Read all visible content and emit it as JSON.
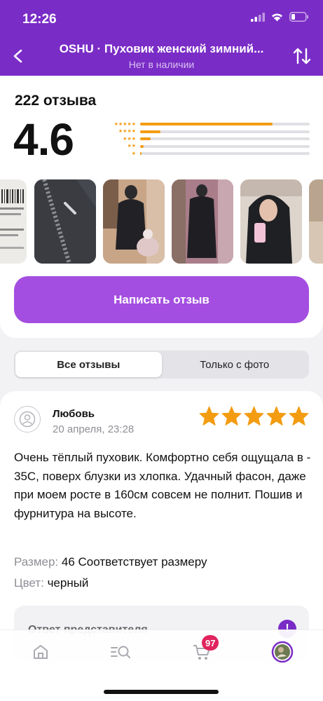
{
  "status_bar": {
    "time": "12:26"
  },
  "header": {
    "title": "OSHU · Пуховик женский зимний...",
    "subtitle": "Нет в наличии"
  },
  "summary": {
    "reviews_count": "222 отзыва",
    "rating": "4.6",
    "distribution": [
      {
        "stars": 5,
        "fraction": 0.78
      },
      {
        "stars": 4,
        "fraction": 0.12
      },
      {
        "stars": 3,
        "fraction": 0.06
      },
      {
        "stars": 2,
        "fraction": 0.02
      },
      {
        "stars": 1,
        "fraction": 0.01
      }
    ],
    "accent_color": "#f39c12"
  },
  "actions": {
    "write_review": "Написать отзыв"
  },
  "tabs": [
    {
      "label": "Все отзывы",
      "active": true
    },
    {
      "label": "Только с фото",
      "active": false
    }
  ],
  "review": {
    "author": "Любовь",
    "date": "20 апреля, 23:28",
    "stars": 5,
    "text": "Очень тёплый пуховик. Комфортно себя ощущала в - 35С, поверх блузки из хлопка. Удачный фасон, даже при моем росте в 160см совсем не полнит. Пошив и фурнитура на высоте.",
    "size_label": "Размер:",
    "size_value": "46 Соответствует размеру",
    "color_label": "Цвет:",
    "color_value": "черный",
    "rep_title": "Ответ представителя"
  },
  "bottom_nav": {
    "cart_badge": "97"
  },
  "colors": {
    "brand": "#7a2cc6",
    "button": "#a34ee0",
    "star": "#f39c12"
  }
}
